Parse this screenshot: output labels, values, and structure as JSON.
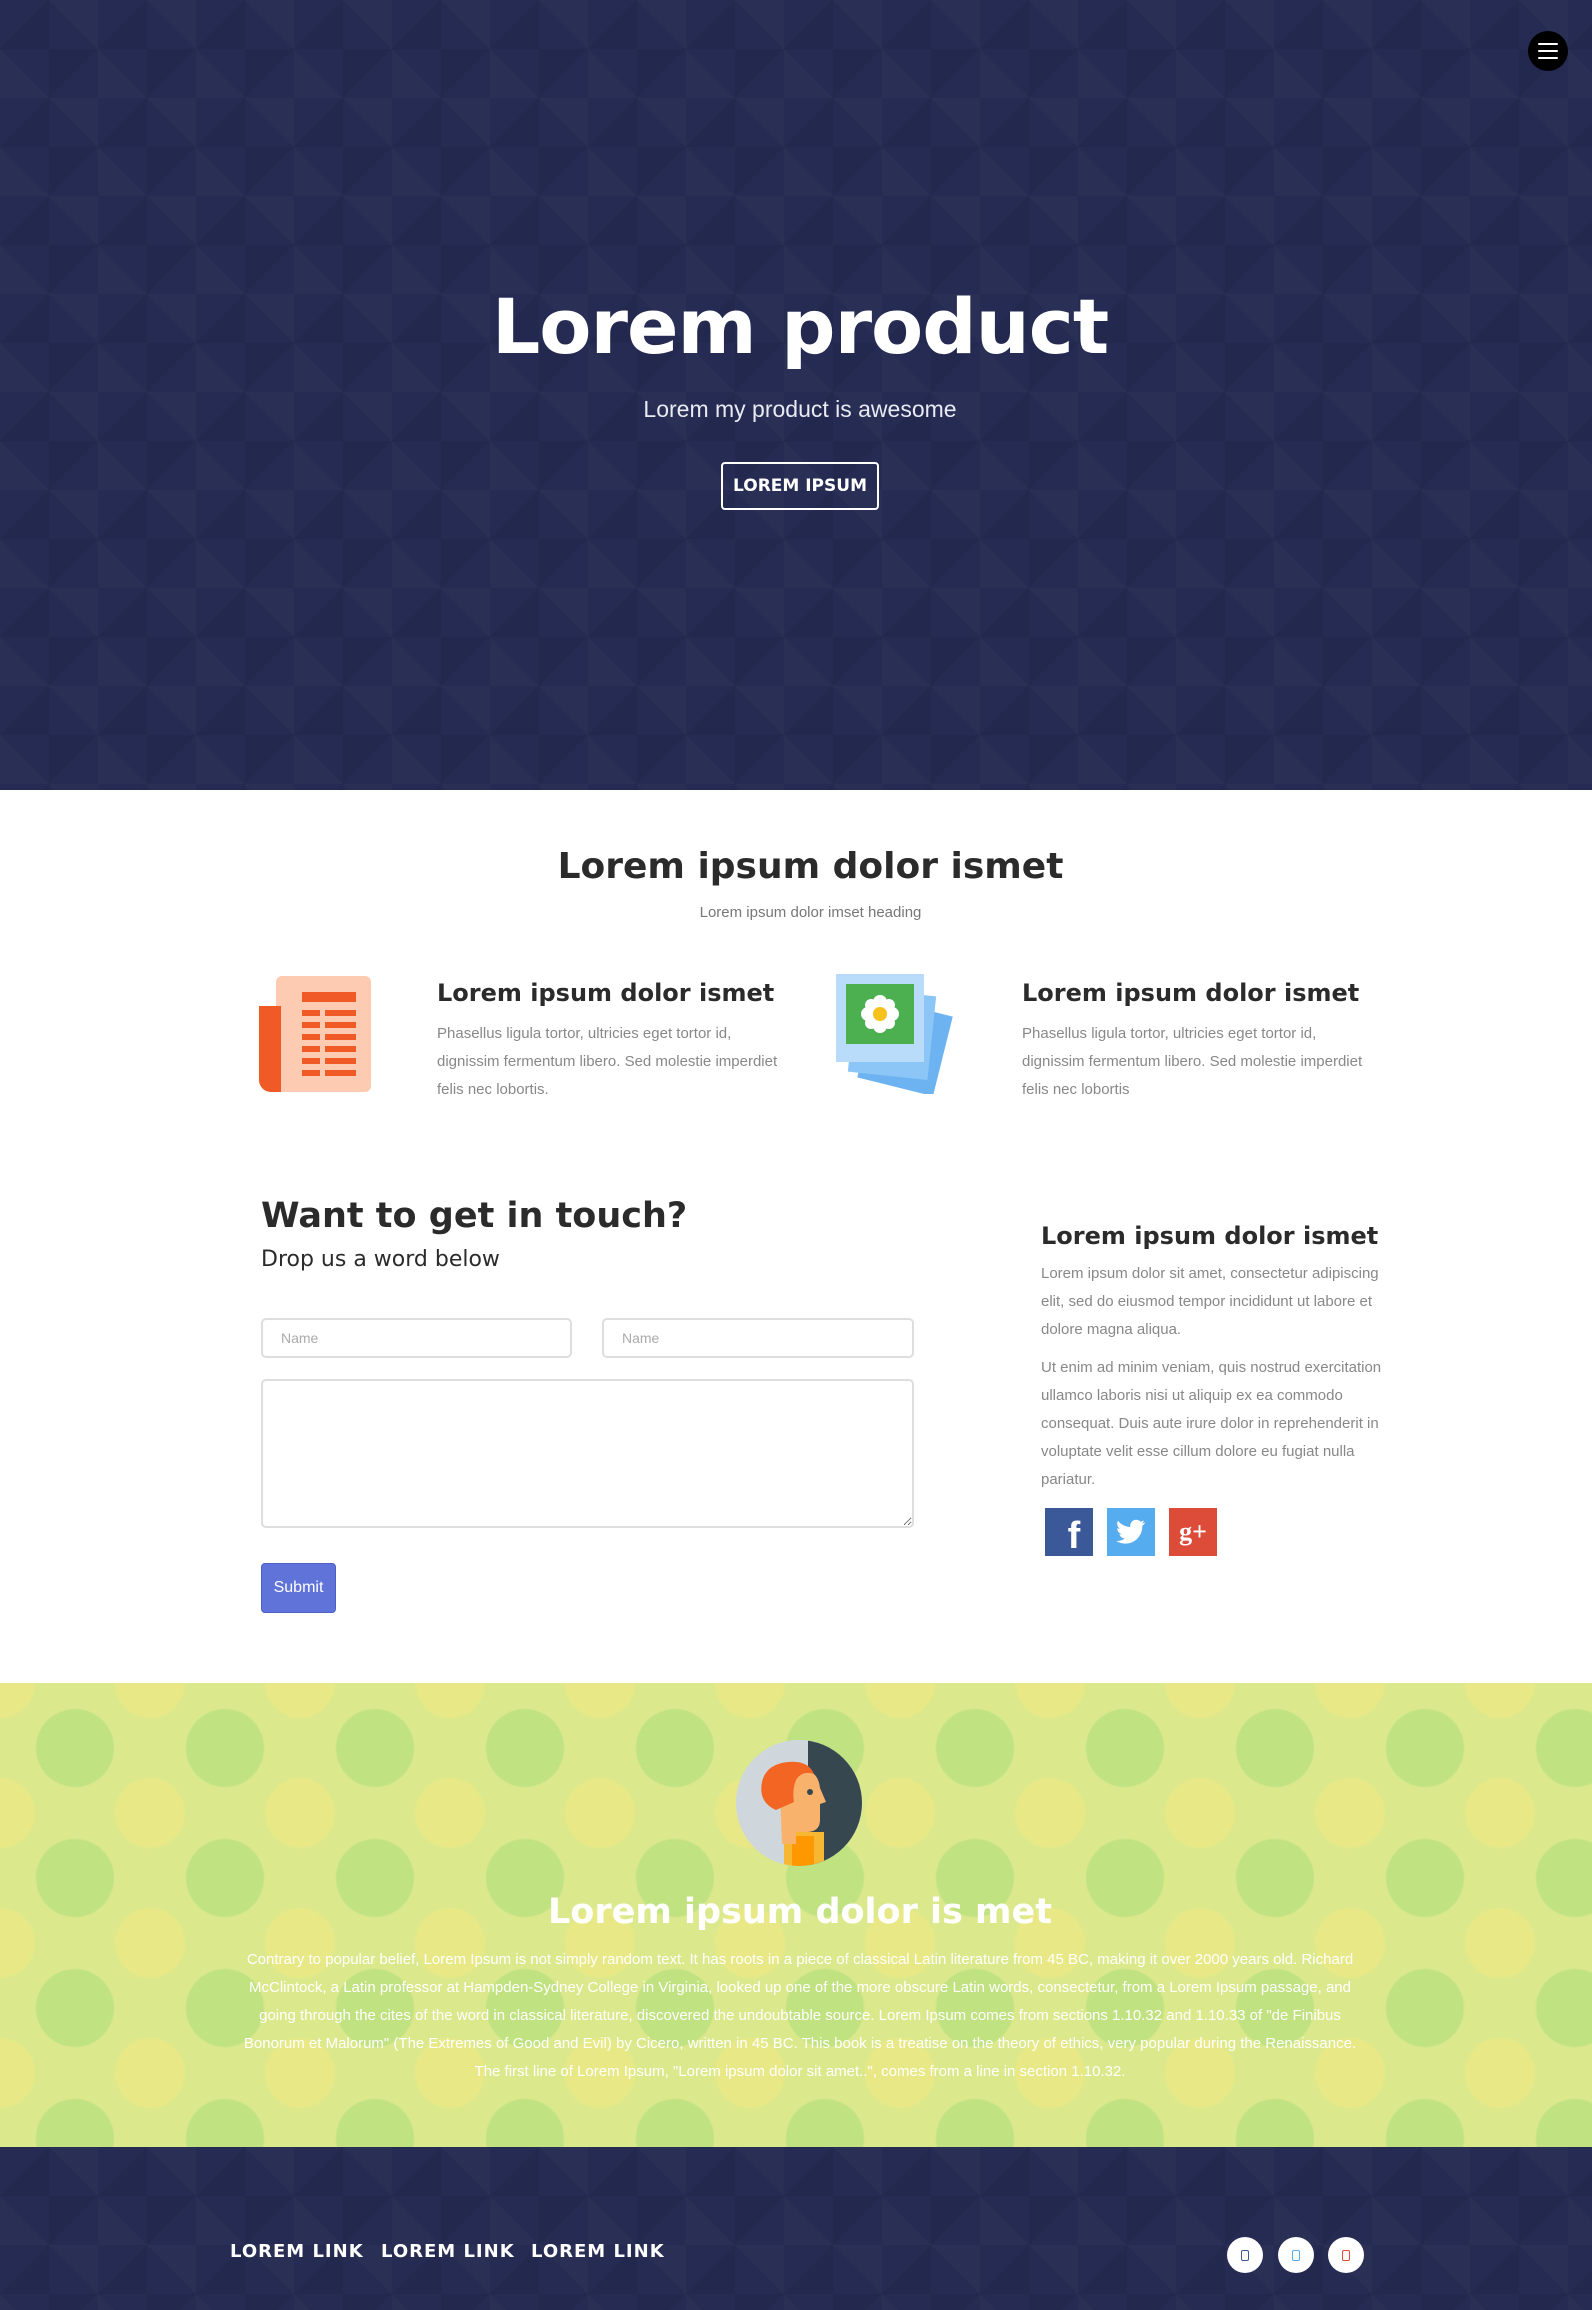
{
  "hero": {
    "title": "Lorem product",
    "subtitle": "Lorem my product is awesome",
    "button_label": "LOREM IPSUM",
    "menu_icon": "hamburger-menu-icon"
  },
  "features": {
    "title": "Lorem ipsum dolor ismet",
    "subtitle": "Lorem ipsum dolor imset heading",
    "items": [
      {
        "icon": "newspaper-icon",
        "title": "Lorem ipsum dolor ismet",
        "lines": [
          "Phasellus ligula tortor, ultricies eget tortor id,",
          "dignissim fermentum libero. Sed molestie imperdiet",
          "felis nec lobortis."
        ]
      },
      {
        "icon": "photos-icon",
        "title": "Lorem ipsum dolor ismet",
        "lines": [
          "Phasellus ligula tortor, ultricies eget tortor id,",
          "dignissim fermentum libero. Sed molestie imperdiet",
          "felis nec lobortis"
        ]
      }
    ]
  },
  "contact": {
    "title": "Want to get in touch?",
    "subtitle": "Drop us a word below",
    "name_placeholder_1": "Name",
    "name_placeholder_2": "Name",
    "message_value": "",
    "submit_label": "Submit"
  },
  "sidebar": {
    "title": "Lorem ipsum dolor ismet",
    "para1_lines": [
      "Lorem ipsum dolor sit amet, consectetur adipiscing",
      "elit, sed do eiusmod tempor incididunt ut labore et",
      "dolore magna aliqua."
    ],
    "para2_lines": [
      "Ut enim ad minim veniam, quis nostrud exercitation",
      "ullamco laboris nisi ut aliquip ex ea commodo",
      "consequat. Duis aute irure dolor in reprehenderit in",
      "voluptate velit esse cillum dolore eu fugiat nulla",
      "pariatur."
    ],
    "social": [
      {
        "icon": "facebook-icon",
        "glyph": "f",
        "color": "#3b5998"
      },
      {
        "icon": "twitter-icon",
        "glyph": "t",
        "color": "#55acee"
      },
      {
        "icon": "google-plus-icon",
        "glyph": "g+",
        "color": "#dd4b39"
      }
    ]
  },
  "testimonial": {
    "avatar_icon": "person-avatar-icon",
    "title": "Lorem ipsum dolor is met",
    "lines": [
      "Contrary to popular belief, Lorem Ipsum is not simply random text. It has roots in a piece of classical Latin literature from 45 BC, making it over 2000 years old. Richard",
      "McClintock, a Latin professor at Hampden-Sydney College in Virginia, looked up one of the more obscure Latin words, consectetur, from a Lorem Ipsum passage, and",
      "going through the cites of the word in classical literature, discovered the undoubtable source. Lorem Ipsum comes from sections 1.10.32 and 1.10.33 of \"de Finibus",
      "Bonorum et Malorum\" (The Extremes of Good and Evil) by Cicero, written in 45 BC. This book is a treatise on the theory of ethics, very popular during the Renaissance.",
      "The first line of Lorem Ipsum, \"Lorem ipsum dolor sit amet..\", comes from a line in section 1.10.32."
    ]
  },
  "footer": {
    "links": [
      "LOREM LINK",
      "LOREM LINK",
      "LOREM LINK"
    ],
    "social": [
      {
        "icon": "facebook-icon",
        "color": "#3b5998"
      },
      {
        "icon": "twitter-icon",
        "color": "#55acee"
      },
      {
        "icon": "google-plus-icon",
        "color": "#dd4b39"
      }
    ]
  },
  "colors": {
    "hero_bg": "#252b52",
    "submit": "#5f73d8",
    "testimonial_bg": "#dbe98c"
  }
}
